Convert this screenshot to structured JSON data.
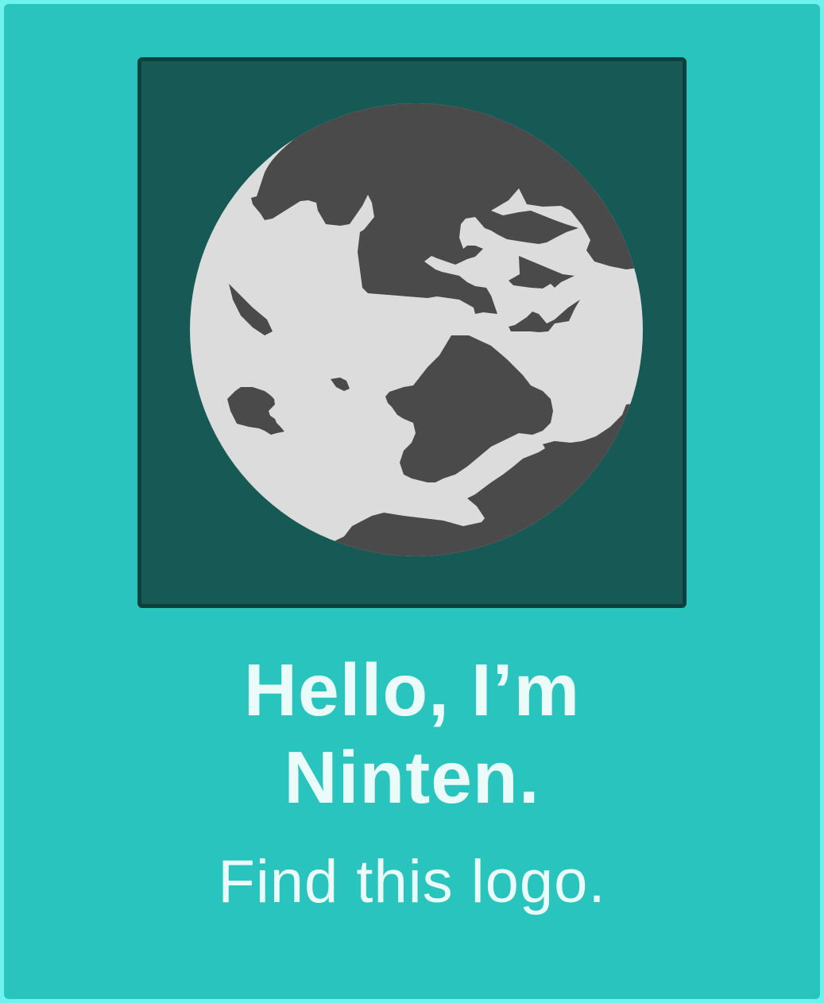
{
  "card": {
    "title_line1": "Hello, I’m",
    "title_line2": "Ninten.",
    "subtitle": "Find this logo."
  },
  "logo": {
    "icon": "globe-icon"
  },
  "colors": {
    "page_border": "#6ef2ee",
    "card_background": "#28c4bd",
    "logo_background": "#175a55",
    "logo_border": "#0b403d",
    "globe_ocean": "#dcdcdc",
    "globe_land": "#4a4a4a",
    "text": "#ebfbfa"
  }
}
